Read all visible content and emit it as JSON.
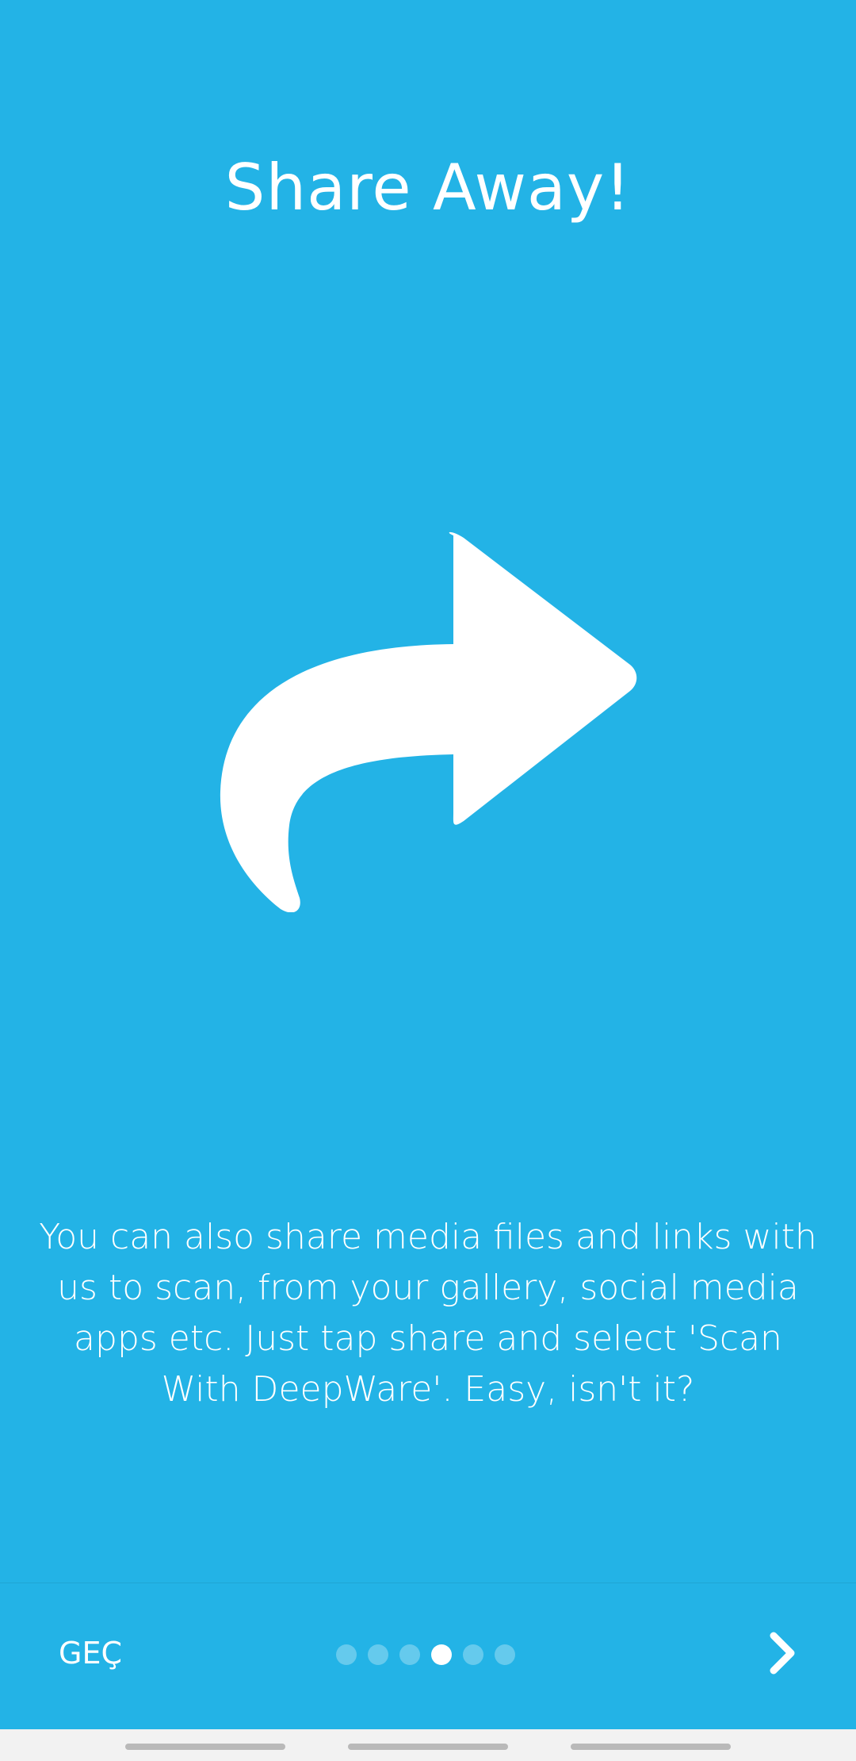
{
  "onboarding": {
    "title": "Share Away!",
    "illustration_icon": "share-forward-arrow-icon",
    "description": "You can also share media files and links with us to scan, from your gallery, social media apps etc. Just tap share and select 'Scan With DeepWare'. Easy, isn't it?"
  },
  "bottom_bar": {
    "skip_label": "GEÇ",
    "page_indicator": {
      "total": 6,
      "current": 4
    },
    "next_icon": "chevron-right-icon"
  },
  "colors": {
    "background": "#23b3e6",
    "foreground": "#ffffff"
  }
}
